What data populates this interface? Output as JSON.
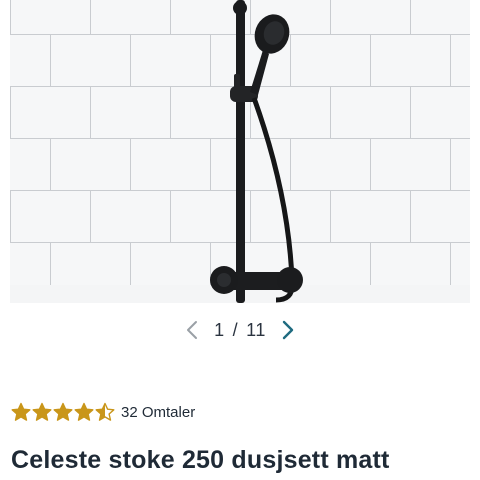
{
  "gallery": {
    "current": "1",
    "separator": "/",
    "total": "11"
  },
  "rating": {
    "score": 4.5,
    "max": 5,
    "reviews_label": "32 Omtaler",
    "star_color": "#c9961a",
    "star_empty_color": "#c9961a"
  },
  "product": {
    "title": "Celeste stoke 250 dusjsett matt"
  },
  "colors": {
    "accent_arrow": "#1f6b80",
    "text": "#1f2a36"
  },
  "icons": {
    "prev": "chevron-left-icon",
    "next": "chevron-right-icon",
    "star": "star-icon"
  }
}
